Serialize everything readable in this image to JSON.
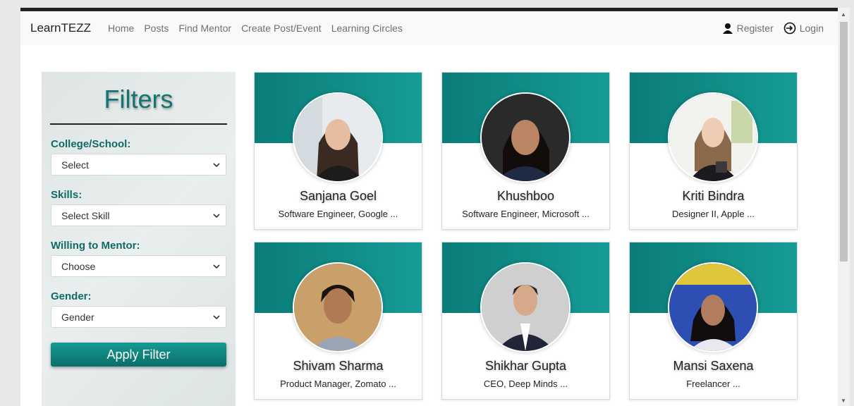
{
  "nav": {
    "brand": "LearnTEZZ",
    "links": [
      "Home",
      "Posts",
      "Find Mentor",
      "Create Post/Event",
      "Learning Circles"
    ],
    "register": "Register",
    "login": "Login"
  },
  "filters": {
    "title": "Filters",
    "groups": [
      {
        "label": "College/School:",
        "value": "Select"
      },
      {
        "label": "Skills:",
        "value": "Select Skill"
      },
      {
        "label": "Willing to Mentor:",
        "value": "Choose"
      },
      {
        "label": "Gender:",
        "value": "Gender"
      }
    ],
    "apply_label": "Apply Filter"
  },
  "mentors": [
    {
      "name": "Sanjana Goel",
      "role": "Software Engineer, Google ..."
    },
    {
      "name": "Khushboo",
      "role": "Software Engineer, Microsoft ..."
    },
    {
      "name": "Kriti Bindra",
      "role": "Designer II, Apple ..."
    },
    {
      "name": "Shivam Sharma",
      "role": "Product Manager, Zomato ..."
    },
    {
      "name": "Shikhar Gupta",
      "role": "CEO, Deep Minds ..."
    },
    {
      "name": "Mansi Saxena",
      "role": "Freelancer ..."
    }
  ],
  "colors": {
    "accent": "#14746f",
    "card_header": "#0f8a85",
    "button": "#108580"
  }
}
